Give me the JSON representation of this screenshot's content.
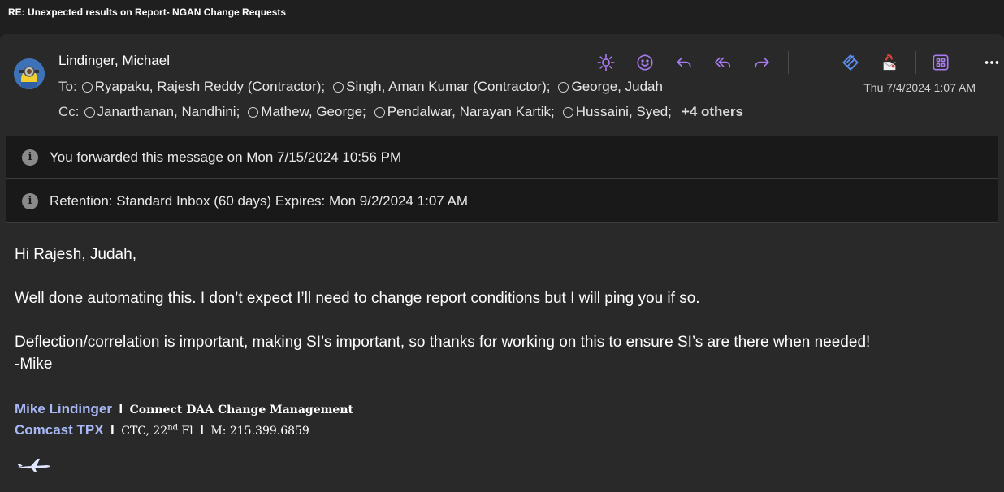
{
  "window": {
    "title": "RE: Unexpected results on Report- NGAN Change Requests"
  },
  "message": {
    "sender": "Lindinger, Michael",
    "to_label": "To:",
    "to": [
      "Ryapaku, Rajesh Reddy (Contractor);",
      "Singh, Aman Kumar (Contractor);",
      "George, Judah"
    ],
    "cc_label": "Cc:",
    "cc": [
      "Janarthanan, Nandhini;",
      "Mathew, George;",
      "Pendalwar, Narayan Kartik;",
      "Hussaini, Syed;"
    ],
    "cc_more": "+4 others",
    "date": "Thu 7/4/2024 1:07 AM"
  },
  "toolbar": {
    "icons": [
      "sun-icon",
      "smiley-icon",
      "reply-icon",
      "reply-all-icon",
      "forward-icon",
      "viva-insights-icon",
      "report-message-icon",
      "apps-icon",
      "more-icon"
    ]
  },
  "info_bars": {
    "forwarded": "You forwarded this message on Mon 7/15/2024 10:56 PM",
    "retention": "Retention: Standard Inbox (60 days) Expires: Mon 9/2/2024 1:07 AM"
  },
  "body": {
    "greeting": "Hi Rajesh, Judah,",
    "para1": "Well done automating this. I don’t expect I’ll need to change report conditions but I will ping you if so.",
    "para2": "Deflection/correlation is important, making SI’s important, so thanks for working on this to ensure SI’s are there when needed!",
    "signoff": "-Mike"
  },
  "signature": {
    "name": "Mike Lindinger",
    "sep": "l",
    "role": "Connect DAA Change Management",
    "company": "Comcast TPX",
    "location_pre": "CTC, 22",
    "location_sup": "nd",
    "location_post": " Fl",
    "mobile": "M: 215.399.6859"
  },
  "colors": {
    "accent": "#a87bf0",
    "link": "#a7b8f5",
    "viva": "#5b8ef0"
  }
}
